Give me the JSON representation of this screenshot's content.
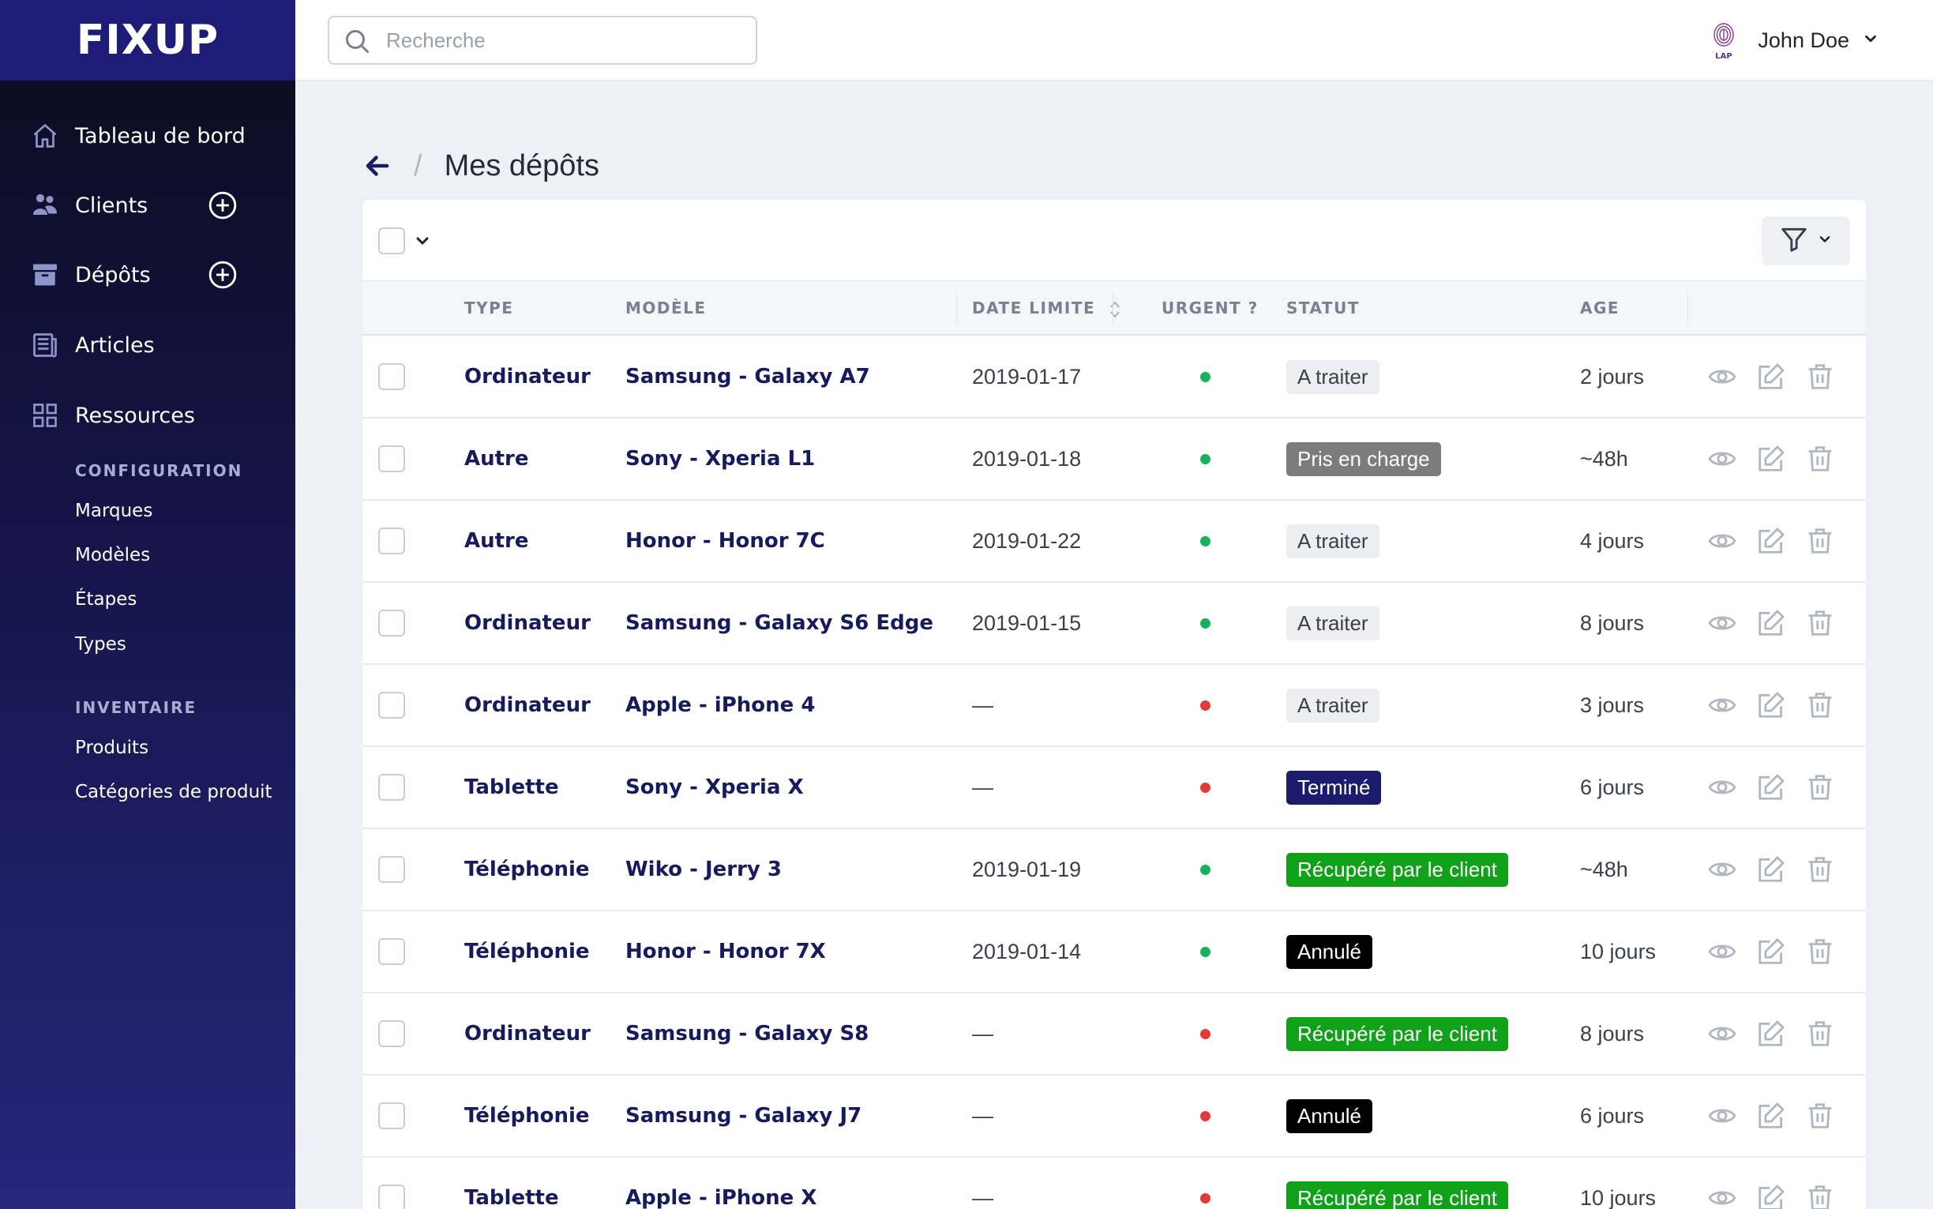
{
  "app": {
    "logo": "FIXUP"
  },
  "colors": {
    "brand": "#1d1d78",
    "link": "#161a5e",
    "urgent_yes": "#e33b3b",
    "urgent_no": "#16b25c"
  },
  "sidebar": {
    "nav": [
      {
        "label": "Tableau de bord",
        "icon": "home-icon",
        "has_add": false
      },
      {
        "label": "Clients",
        "icon": "users-icon",
        "has_add": true
      },
      {
        "label": "Dépôts",
        "icon": "archive-icon",
        "has_add": true
      },
      {
        "label": "Articles",
        "icon": "newspaper-icon",
        "has_add": false
      },
      {
        "label": "Ressources",
        "icon": "grid-icon",
        "has_add": false
      }
    ],
    "sections": [
      {
        "title": "CONFIGURATION",
        "items": [
          "Marques",
          "Modèles",
          "Étapes",
          "Types"
        ]
      },
      {
        "title": "INVENTAIRE",
        "items": [
          "Produits",
          "Catégories de produit"
        ]
      }
    ]
  },
  "header": {
    "search_placeholder": "Recherche",
    "search_value": "",
    "user_name": "John Doe",
    "avatar_icon": "fingerprint-logo-icon"
  },
  "breadcrumb": {
    "separator": "/",
    "title": "Mes dépôts"
  },
  "table": {
    "columns": [
      "TYPE",
      "MODÈLE",
      "DATE LIMITE",
      "URGENT ?",
      "STATUT",
      "AGE"
    ],
    "sortable_column": "DATE LIMITE",
    "status_styles": {
      "A traiter": {
        "bg": "#eceef1",
        "fg": "#3a3e4a"
      },
      "Pris en charge": {
        "bg": "#7c7c7c",
        "fg": "#ffffff"
      },
      "Terminé": {
        "bg": "#1c1c6e",
        "fg": "#ffffff"
      },
      "Récupéré par le client": {
        "bg": "#0fa218",
        "fg": "#ffffff"
      },
      "Annulé": {
        "bg": "#000000",
        "fg": "#ffffff"
      }
    },
    "rows": [
      {
        "type": "Ordinateur",
        "model": "Samsung - Galaxy A7",
        "date": "2019-01-17",
        "urgent": false,
        "status": "A traiter",
        "age": "2 jours"
      },
      {
        "type": "Autre",
        "model": "Sony - Xperia L1",
        "date": "2019-01-18",
        "urgent": false,
        "status": "Pris en charge",
        "age": "~48h"
      },
      {
        "type": "Autre",
        "model": "Honor - Honor 7C",
        "date": "2019-01-22",
        "urgent": false,
        "status": "A traiter",
        "age": "4 jours"
      },
      {
        "type": "Ordinateur",
        "model": "Samsung - Galaxy S6 Edge",
        "date": "2019-01-15",
        "urgent": false,
        "status": "A traiter",
        "age": "8 jours"
      },
      {
        "type": "Ordinateur",
        "model": "Apple - iPhone 4",
        "date": "—",
        "urgent": true,
        "status": "A traiter",
        "age": "3 jours"
      },
      {
        "type": "Tablette",
        "model": "Sony - Xperia X",
        "date": "—",
        "urgent": true,
        "status": "Terminé",
        "age": "6 jours"
      },
      {
        "type": "Téléphonie",
        "model": "Wiko - Jerry 3",
        "date": "2019-01-19",
        "urgent": false,
        "status": "Récupéré par le client",
        "age": "~48h"
      },
      {
        "type": "Téléphonie",
        "model": "Honor - Honor 7X",
        "date": "2019-01-14",
        "urgent": false,
        "status": "Annulé",
        "age": "10 jours"
      },
      {
        "type": "Ordinateur",
        "model": "Samsung - Galaxy S8",
        "date": "—",
        "urgent": true,
        "status": "Récupéré par le client",
        "age": "8 jours"
      },
      {
        "type": "Téléphonie",
        "model": "Samsung - Galaxy J7",
        "date": "—",
        "urgent": true,
        "status": "Annulé",
        "age": "6 jours"
      },
      {
        "type": "Tablette",
        "model": "Apple - iPhone X",
        "date": "—",
        "urgent": true,
        "status": "Récupéré par le client",
        "age": "10 jours"
      }
    ],
    "row_actions": [
      "eye-icon",
      "edit-icon",
      "trash-icon"
    ]
  }
}
